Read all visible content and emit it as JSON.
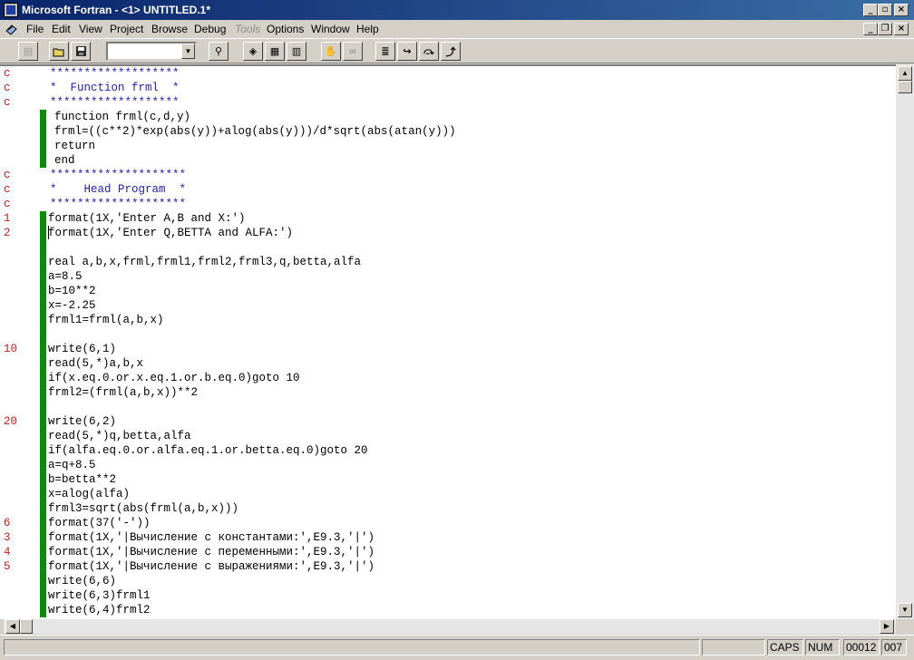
{
  "window": {
    "title": "Microsoft Fortran - <1> UNTITLED.1*"
  },
  "menu": [
    "File",
    "Edit",
    "View",
    "Project",
    "Browse",
    "Debug",
    "Tools",
    "Options",
    "Window",
    "Help"
  ],
  "toolbar": {
    "combo_value": ""
  },
  "code_lines": [
    {
      "label": "c",
      "code": "*******************",
      "kind": "cmt"
    },
    {
      "label": "c",
      "code": "*  Function frml  *",
      "kind": "cmt"
    },
    {
      "label": "c",
      "code": "*******************",
      "kind": "cmt"
    },
    {
      "label": "",
      "code": "function frml(c,d,y)",
      "kind": "fn",
      "bar": true
    },
    {
      "label": "",
      "code": "frml=((c**2)*exp(abs(y))+alog(abs(y)))/d*sqrt(abs(atan(y)))",
      "kind": "fn",
      "bar": true
    },
    {
      "label": "",
      "code": "return",
      "kind": "fn",
      "bar": true
    },
    {
      "label": "",
      "code": "end",
      "kind": "fn",
      "bar": true
    },
    {
      "label": "c",
      "code": "********************",
      "kind": "cmt"
    },
    {
      "label": "c",
      "code": "*    Head Program  *",
      "kind": "cmt"
    },
    {
      "label": "c",
      "code": "********************",
      "kind": "cmt"
    },
    {
      "label": "1",
      "code": "format(1X,'Enter A,B and X:')",
      "bar": true
    },
    {
      "label": "2",
      "code": "format(1X,'Enter Q,BETTA and ALFA:')",
      "bar": true,
      "caret": true
    },
    {
      "label": "",
      "code": "",
      "bar": true
    },
    {
      "label": "",
      "code": "real a,b,x,frml,frml1,frml2,frml3,q,betta,alfa",
      "bar": true
    },
    {
      "label": "",
      "code": "a=8.5",
      "bar": true
    },
    {
      "label": "",
      "code": "b=10**2",
      "bar": true
    },
    {
      "label": "",
      "code": "x=-2.25",
      "bar": true
    },
    {
      "label": "",
      "code": "frml1=frml(a,b,x)",
      "bar": true
    },
    {
      "label": "",
      "code": "",
      "bar": true
    },
    {
      "label": "10",
      "code": "write(6,1)",
      "bar": true
    },
    {
      "label": "",
      "code": "read(5,*)a,b,x",
      "bar": true
    },
    {
      "label": "",
      "code": "if(x.eq.0.or.x.eq.1.or.b.eq.0)goto 10",
      "bar": true
    },
    {
      "label": "",
      "code": "frml2=(frml(a,b,x))**2",
      "bar": true
    },
    {
      "label": "",
      "code": "",
      "bar": true
    },
    {
      "label": "20",
      "code": "write(6,2)",
      "bar": true
    },
    {
      "label": "",
      "code": "read(5,*)q,betta,alfa",
      "bar": true
    },
    {
      "label": "",
      "code": "if(alfa.eq.0.or.alfa.eq.1.or.betta.eq.0)goto 20",
      "bar": true
    },
    {
      "label": "",
      "code": "a=q+8.5",
      "bar": true
    },
    {
      "label": "",
      "code": "b=betta**2",
      "bar": true
    },
    {
      "label": "",
      "code": "x=alog(alfa)",
      "bar": true
    },
    {
      "label": "",
      "code": "frml3=sqrt(abs(frml(a,b,x)))",
      "bar": true
    },
    {
      "label": "6",
      "code": "format(37('-'))",
      "bar": true
    },
    {
      "label": "3",
      "code": "format(1X,'|Вычисление с константами:',E9.3,'|')",
      "bar": true
    },
    {
      "label": "4",
      "code": "format(1X,'|Вычисление с переменными:',E9.3,'|')",
      "bar": true
    },
    {
      "label": "5",
      "code": "format(1X,'|Вычисление с выражениями:',E9.3,'|')",
      "bar": true
    },
    {
      "label": "",
      "code": "write(6,6)",
      "bar": true
    },
    {
      "label": "",
      "code": "write(6,3)frml1",
      "bar": true
    },
    {
      "label": "",
      "code": "write(6,4)frml2",
      "bar": true
    }
  ],
  "status": {
    "caps": "CAPS",
    "num": "NUM",
    "line": "00012",
    "col": "007"
  },
  "colors": {
    "title_start": "#0a246a",
    "title_end": "#3a6ea5",
    "change_bar": "#0d8a0d",
    "label": "#cc2020",
    "comment": "#1f1fb0"
  }
}
